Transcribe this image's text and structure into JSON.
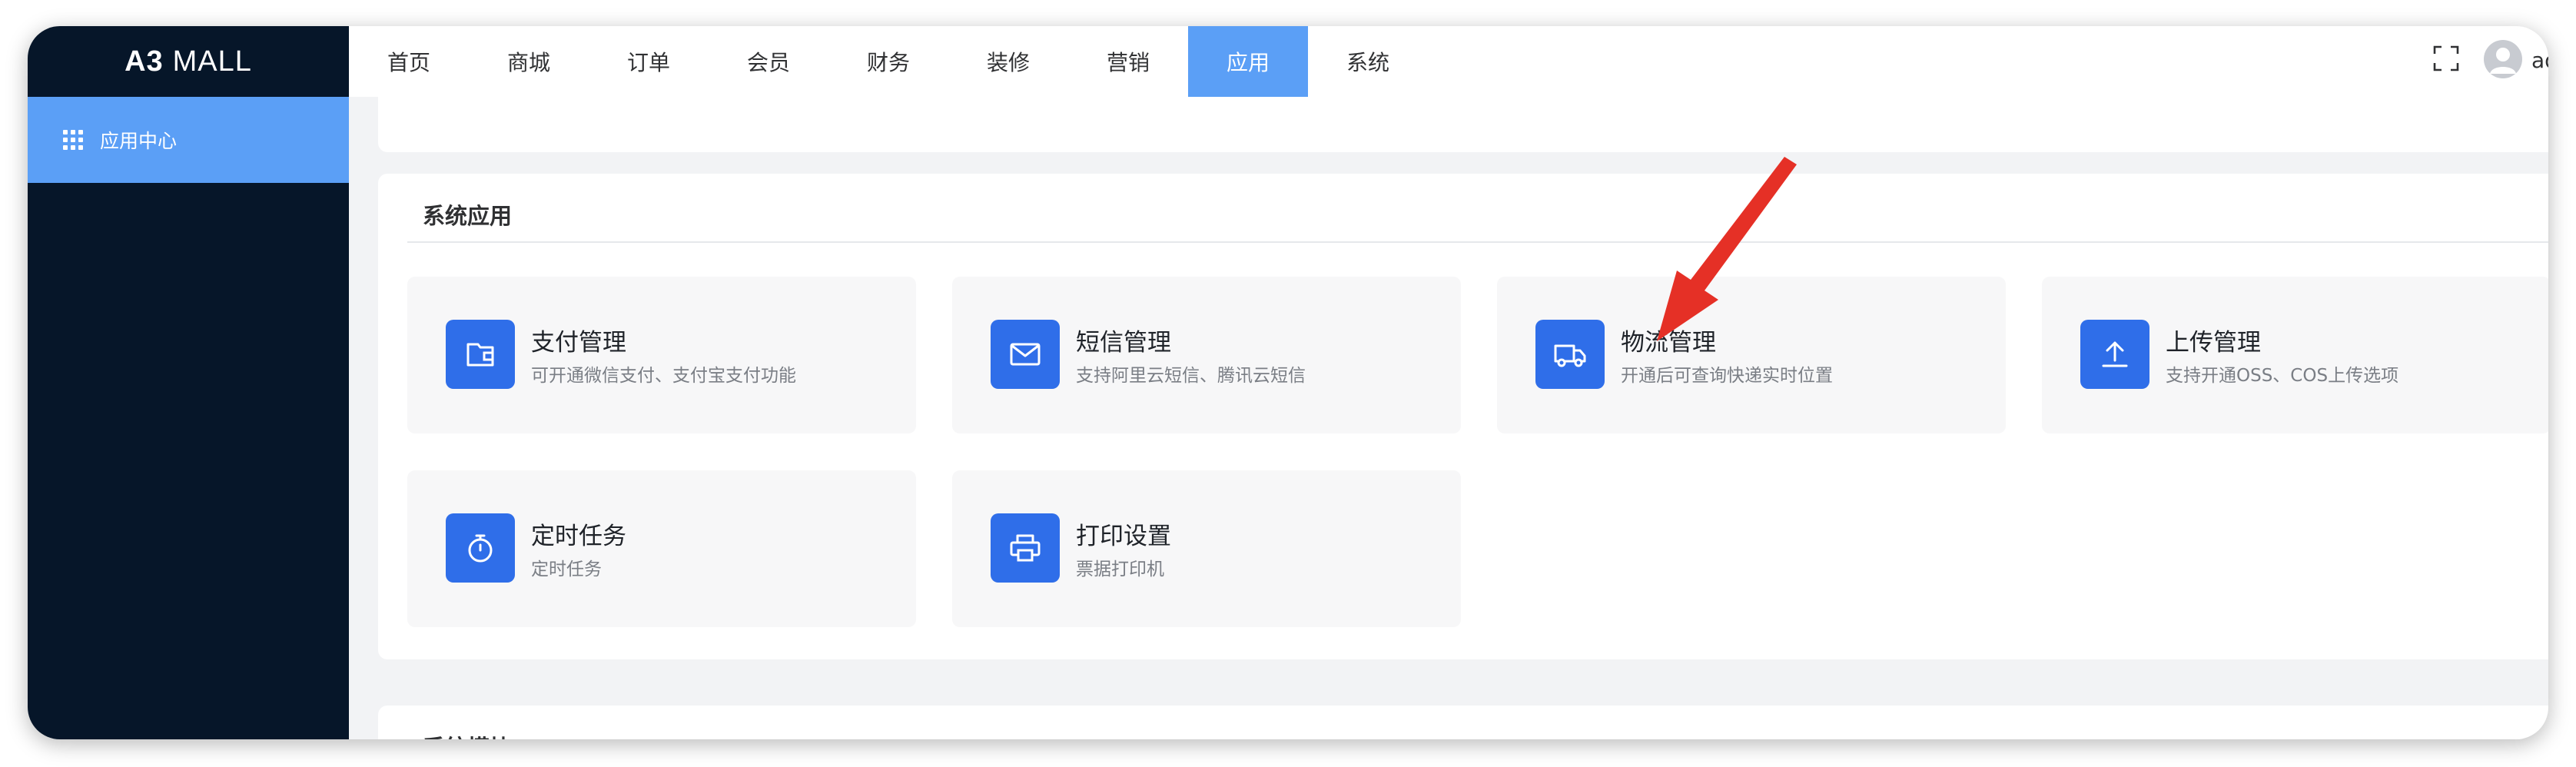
{
  "brand": {
    "logo_bold": "A3",
    "logo_light": "MALL"
  },
  "sidebar": {
    "items": [
      {
        "label": "应用中心",
        "icon": "grid-icon"
      }
    ]
  },
  "topnav": {
    "items": [
      {
        "label": "首页"
      },
      {
        "label": "商城"
      },
      {
        "label": "订单"
      },
      {
        "label": "会员"
      },
      {
        "label": "财务"
      },
      {
        "label": "装修"
      },
      {
        "label": "营销"
      },
      {
        "label": "应用",
        "active": true
      },
      {
        "label": "系统"
      }
    ],
    "user": "adm"
  },
  "section": {
    "title": "系统应用",
    "cards": [
      {
        "title": "支付管理",
        "desc": "可开通微信支付、支付宝支付功能",
        "icon": "wallet-icon"
      },
      {
        "title": "短信管理",
        "desc": "支持阿里云短信、腾讯云短信",
        "icon": "mail-icon"
      },
      {
        "title": "物流管理",
        "desc": "开通后可查询快递实时位置",
        "icon": "truck-icon"
      },
      {
        "title": "上传管理",
        "desc": "支持开通OSS、COS上传选项",
        "icon": "upload-icon"
      },
      {
        "title": "定时任务",
        "desc": "定时任务",
        "icon": "timer-icon"
      },
      {
        "title": "打印设置",
        "desc": "票据打印机",
        "icon": "printer-icon"
      }
    ]
  },
  "next_section": {
    "title": "系统模块"
  },
  "colors": {
    "sidebar_bg": "#061629",
    "accent": "#5b9ff6",
    "icon_bg": "#2f6ee9",
    "annotation_arrow": "#e53026"
  }
}
